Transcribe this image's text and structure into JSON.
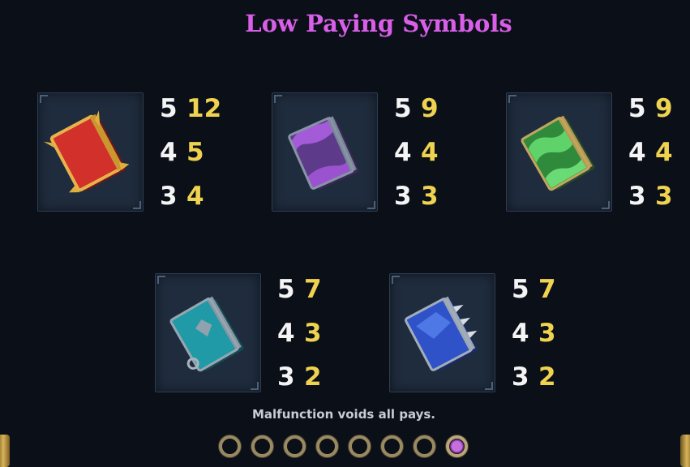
{
  "title": "Low Paying Symbols",
  "colors": {
    "title": "#d95ee8",
    "count": "#f4f4f4",
    "payout": "#efd350",
    "background": "#0b0f18"
  },
  "symbols": [
    {
      "name": "red-book-icon",
      "pays": [
        {
          "count": "5",
          "value": "12"
        },
        {
          "count": "4",
          "value": "5"
        },
        {
          "count": "3",
          "value": "4"
        }
      ]
    },
    {
      "name": "purple-book-icon",
      "pays": [
        {
          "count": "5",
          "value": "9"
        },
        {
          "count": "4",
          "value": "4"
        },
        {
          "count": "3",
          "value": "3"
        }
      ]
    },
    {
      "name": "green-book-icon",
      "pays": [
        {
          "count": "5",
          "value": "9"
        },
        {
          "count": "4",
          "value": "4"
        },
        {
          "count": "3",
          "value": "3"
        }
      ]
    },
    {
      "name": "teal-book-icon",
      "pays": [
        {
          "count": "5",
          "value": "7"
        },
        {
          "count": "4",
          "value": "3"
        },
        {
          "count": "3",
          "value": "2"
        }
      ]
    },
    {
      "name": "blue-book-icon",
      "pays": [
        {
          "count": "5",
          "value": "7"
        },
        {
          "count": "4",
          "value": "3"
        },
        {
          "count": "3",
          "value": "2"
        }
      ]
    }
  ],
  "note": "Malfunction voids all pays.",
  "pagination": {
    "pages": 8,
    "current": 8
  }
}
